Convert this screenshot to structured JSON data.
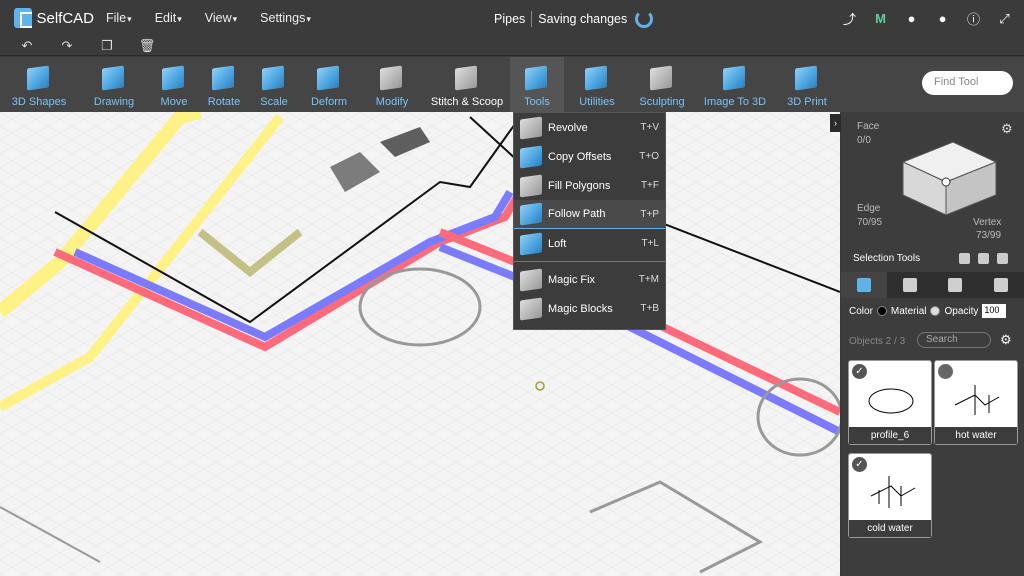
{
  "app": {
    "logo_text": "SelfCAD",
    "project_name": "Pipes",
    "save_status": "Saving changes"
  },
  "menu": [
    "File",
    "Edit",
    "View",
    "Settings"
  ],
  "top_right_icons": [
    "share-icon",
    "m-icon",
    "bell-icon",
    "user-icon",
    "info-icon",
    "fullscreen-icon"
  ],
  "edit_icons": [
    "undo-icon",
    "redo-icon",
    "copy-icon",
    "delete-icon"
  ],
  "toolbar": {
    "items": [
      {
        "label": "3D Shapes",
        "has_menu": true
      },
      {
        "label": "Drawing",
        "has_menu": true
      },
      {
        "label": "Move",
        "has_menu": false
      },
      {
        "label": "Rotate",
        "has_menu": false
      },
      {
        "label": "Scale",
        "has_menu": false
      },
      {
        "label": "Deform",
        "has_menu": true
      },
      {
        "label": "Modify",
        "has_menu": true
      },
      {
        "label": "Stitch & Scoop",
        "has_menu": false
      },
      {
        "label": "Tools",
        "has_menu": true
      },
      {
        "label": "Utilities",
        "has_menu": true
      },
      {
        "label": "Sculpting",
        "has_menu": false
      },
      {
        "label": "Image To 3D",
        "has_menu": false
      },
      {
        "label": "3D Print",
        "has_menu": false
      }
    ],
    "find_placeholder": "Find Tool"
  },
  "tools_menu": [
    {
      "label": "Revolve",
      "shortcut": "T+V"
    },
    {
      "label": "Copy Offsets",
      "shortcut": "T+O"
    },
    {
      "label": "Fill Polygons",
      "shortcut": "T+F"
    },
    {
      "label": "Follow Path",
      "shortcut": "T+P"
    },
    {
      "label": "Loft",
      "shortcut": "T+L"
    },
    {
      "label": "Magic Fix",
      "shortcut": "T+M"
    },
    {
      "label": "Magic Blocks",
      "shortcut": "T+B"
    }
  ],
  "view_cube": {
    "face_label": "Face",
    "face_value": "0/0",
    "edge_label": "Edge",
    "edge_value": "70/95",
    "vertex_label": "Vertex",
    "vertex_value": "73/99"
  },
  "selection_tools_label": "Selection Tools",
  "props": {
    "color_label": "Color",
    "material_label": "Material",
    "opacity_label": "Opacity",
    "opacity_value": "100"
  },
  "objects": {
    "count_label": "Objects 2 / 3",
    "search_placeholder": "Search",
    "items": [
      {
        "name": "profile_6",
        "checked": true
      },
      {
        "name": "hot water",
        "checked": false
      },
      {
        "name": "cold water",
        "checked": true
      }
    ]
  },
  "colors": {
    "accent": "#5fb3e8",
    "pipe_red": "#ff6b7a",
    "pipe_blue": "#7b7bff",
    "pipe_yellow": "#fff27a"
  }
}
